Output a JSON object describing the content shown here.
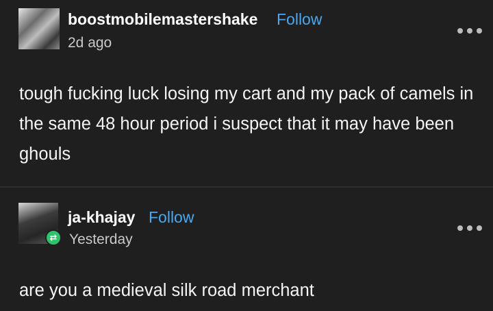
{
  "posts": [
    {
      "username": "boostmobilemastershake",
      "follow_label": "Follow",
      "time": "2d ago",
      "text": "tough fucking luck losing my cart and my pack of camels in the same 48 hour period i suspect that it may have been ghouls",
      "avatar_icon": "user-avatar-icon",
      "more_icon": "more-options-icon"
    },
    {
      "username": "ja-khajay",
      "follow_label": "Follow",
      "time": "Yesterday",
      "text": "are you a medieval silk road merchant",
      "avatar_icon": "user-avatar-icon",
      "badge_icon": "reblog-icon",
      "badge_color": "#2ec26b",
      "more_icon": "more-options-icon"
    }
  ],
  "colors": {
    "background": "#1f1f1f",
    "follow": "#4aa8f0",
    "text": "#f4f4f4"
  }
}
